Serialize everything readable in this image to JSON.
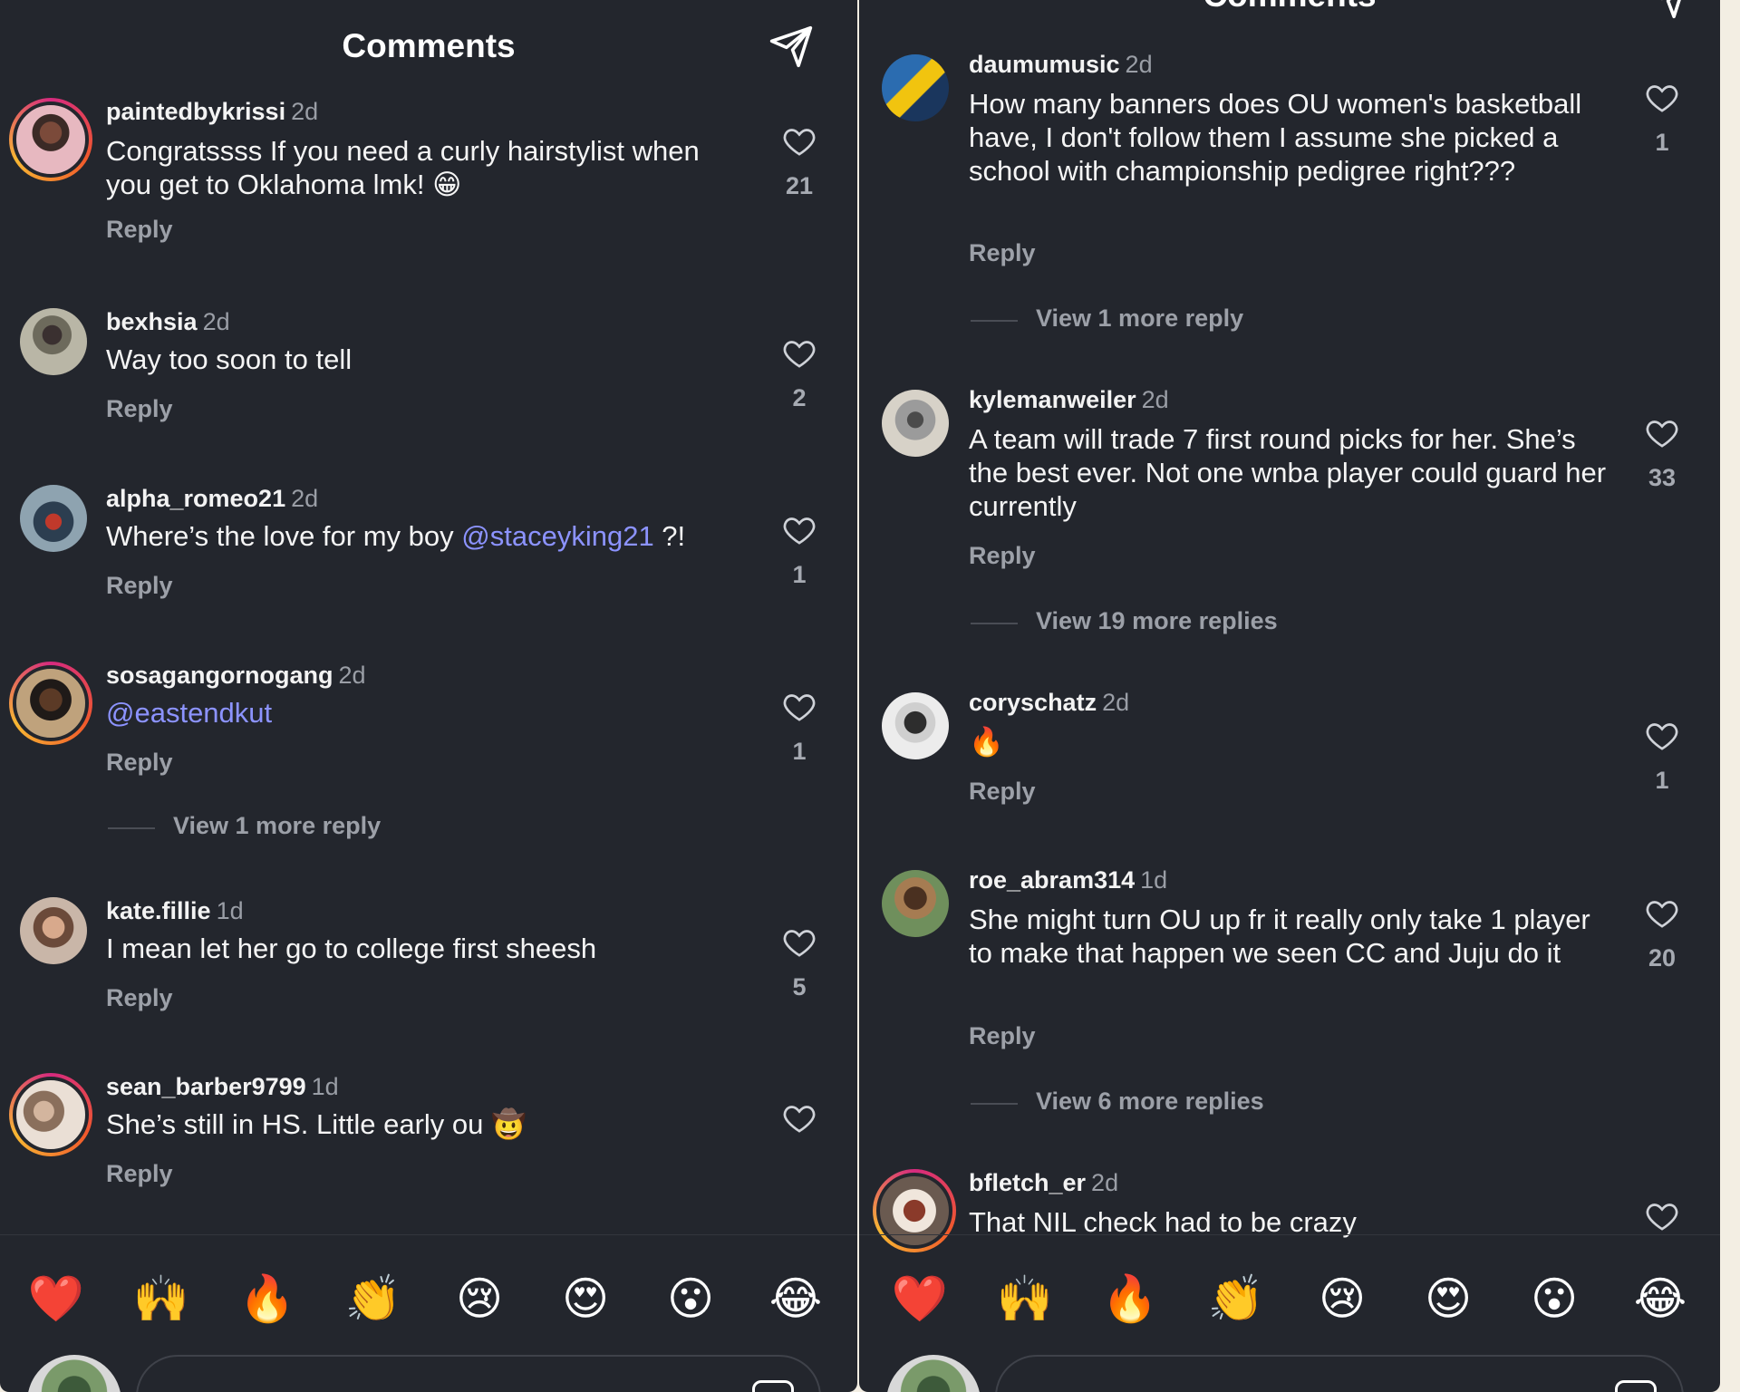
{
  "left": {
    "title": "Comments",
    "comments": [
      {
        "username": "paintedbykrissi",
        "time": "2d",
        "text": "Congratssss If you need a curly hairstylist when you get to Oklahoma lmk! 😁",
        "reply": "Reply",
        "likes": "21",
        "ring": true
      },
      {
        "username": "bexhsia",
        "time": "2d",
        "text": "Way too soon to tell",
        "reply": "Reply",
        "likes": "2",
        "ring": false
      },
      {
        "username": "alpha_romeo21",
        "time": "2d",
        "text_before": "Where’s the love for my boy ",
        "mention": "@staceyking21",
        "text_after": " ?!",
        "reply": "Reply",
        "likes": "1",
        "ring": false
      },
      {
        "username": "sosagangornogang",
        "time": "2d",
        "mention": "@eastendkut",
        "reply": "Reply",
        "likes": "1",
        "ring": true,
        "more": "View 1 more reply"
      },
      {
        "username": "kate.fillie",
        "time": "1d",
        "text": "I mean let her go to college first sheesh",
        "reply": "Reply",
        "likes": "5",
        "ring": false
      },
      {
        "username": "sean_barber9799",
        "time": "1d",
        "text": "She’s still in HS.  Little early ou 🤠",
        "reply": "Reply",
        "likes": "",
        "ring": true
      }
    ]
  },
  "right": {
    "title": "Comments",
    "comments": [
      {
        "username": "daumumusic",
        "time": "2d",
        "text": "How many banners does OU women's basketball have, I don't follow them I assume she picked a school with championship pedigree right???",
        "reply": "Reply",
        "likes": "1",
        "more": "View 1 more reply"
      },
      {
        "username": "kylemanweiler",
        "time": "2d",
        "text": "A team will trade 7 first round picks for her. She’s the best ever. Not one wnba player could guard her currently",
        "reply": "Reply",
        "likes": "33",
        "more": "View 19 more replies"
      },
      {
        "username": "coryschatz",
        "time": "2d",
        "text": "🔥",
        "reply": "Reply",
        "likes": "1"
      },
      {
        "username": "roe_abram314",
        "time": "1d",
        "text": "She might turn OU up fr it really only take 1 player to make that happen we seen CC and Juju do it",
        "reply": "Reply",
        "likes": "20",
        "more": "View 6 more replies"
      },
      {
        "username": "bfletch_er",
        "time": "2d",
        "text": "That NIL check had to be crazy",
        "reply": "",
        "likes": "",
        "ring": true
      }
    ]
  },
  "emoji_bar": [
    "❤️",
    "🙌",
    "🔥",
    "👏",
    "😢",
    "😍",
    "😮",
    "😂"
  ],
  "colors": {
    "background": "#23262d",
    "mention": "#8c93ff",
    "page": "#f3eee3"
  }
}
